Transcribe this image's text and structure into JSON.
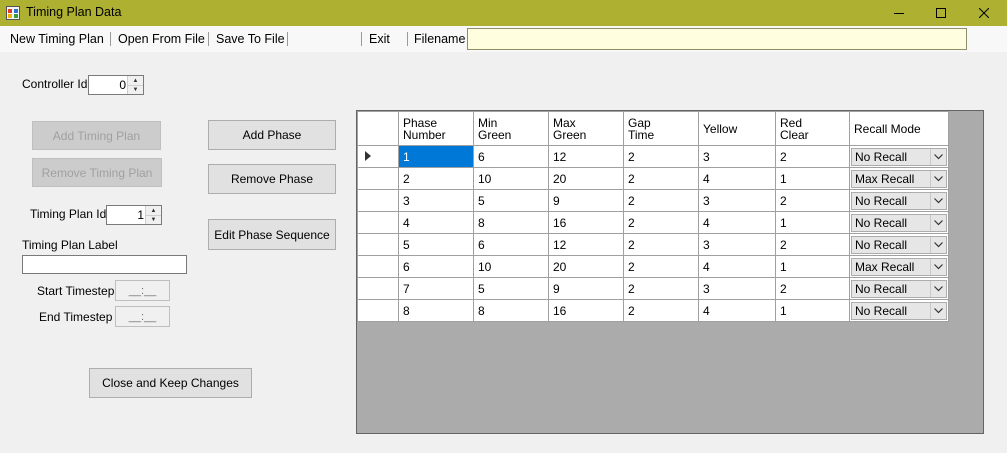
{
  "window": {
    "title": "Timing Plan Data",
    "icons": {
      "app": "app-icon",
      "minimize": "minimize-icon",
      "maximize": "maximize-icon",
      "close": "close-icon"
    }
  },
  "menu": {
    "new_plan": "New Timing Plan",
    "open": "Open From File",
    "save": "Save To File",
    "exit": "Exit",
    "filename_label": "Filename",
    "filename_value": ""
  },
  "left": {
    "controller_id_label": "Controller Id",
    "controller_id_value": "0",
    "add_timing_plan": "Add Timing Plan",
    "remove_timing_plan": "Remove Timing Plan",
    "timing_plan_id_label": "Timing Plan Id",
    "timing_plan_id_value": "1",
    "timing_plan_label_label": "Timing Plan Label",
    "timing_plan_label_value": "",
    "start_timestep_label": "Start Timestep",
    "end_timestep_label": "End Timestep",
    "timestep_placeholder": "__:__",
    "close_keep": "Close and Keep Changes"
  },
  "middle": {
    "add_phase": "Add Phase",
    "remove_phase": "Remove Phase",
    "edit_phase_sequence": "Edit Phase Sequence"
  },
  "grid": {
    "columns": [
      {
        "line1": "Phase",
        "line2": "Number"
      },
      {
        "line1": "Min",
        "line2": "Green"
      },
      {
        "line1": "Max",
        "line2": "Green"
      },
      {
        "line1": "Gap",
        "line2": "Time"
      },
      {
        "line1": "Yellow",
        "line2": ""
      },
      {
        "line1": "Red",
        "line2": "Clear"
      },
      {
        "line1": "Recall Mode",
        "line2": ""
      }
    ],
    "rows": [
      [
        "1",
        "6",
        "12",
        "2",
        "3",
        "2",
        "No Recall"
      ],
      [
        "2",
        "10",
        "20",
        "2",
        "4",
        "1",
        "Max Recall"
      ],
      [
        "3",
        "5",
        "9",
        "2",
        "3",
        "2",
        "No Recall"
      ],
      [
        "4",
        "8",
        "16",
        "2",
        "4",
        "1",
        "No Recall"
      ],
      [
        "5",
        "6",
        "12",
        "2",
        "3",
        "2",
        "No Recall"
      ],
      [
        "6",
        "10",
        "20",
        "2",
        "4",
        "1",
        "Max Recall"
      ],
      [
        "7",
        "5",
        "9",
        "2",
        "3",
        "2",
        "No Recall"
      ],
      [
        "8",
        "8",
        "16",
        "2",
        "4",
        "1",
        "No Recall"
      ]
    ],
    "selected_row": 0
  },
  "colors": {
    "titlebar": "#adb030",
    "selection": "#0078d7",
    "filename_bg": "#ffffe0"
  }
}
